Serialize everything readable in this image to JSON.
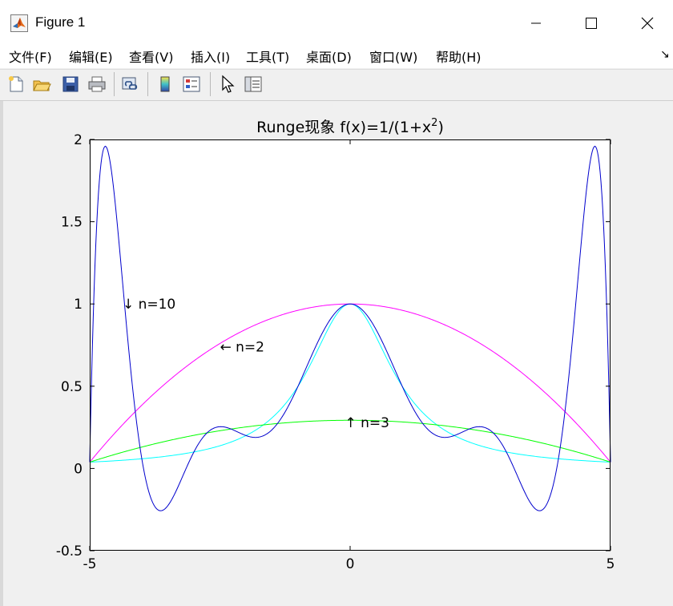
{
  "window": {
    "title": "Figure 1",
    "colors": {
      "titlebar": "#ffffff",
      "toolbar": "#f0f0f0",
      "figure_bg": "#f0f0f0"
    }
  },
  "menu": [
    "文件(F)",
    "编辑(E)",
    "查看(V)",
    "插入(I)",
    "工具(T)",
    "桌面(D)",
    "窗口(W)",
    "帮助(H)"
  ],
  "toolbar_icons": [
    "new-figure-icon",
    "open-file-icon",
    "save-icon",
    "print-icon",
    "link-plot-icon",
    "colorbar-icon",
    "legend-icon",
    "pointer-icon",
    "property-inspector-icon"
  ],
  "chart_data": {
    "type": "line",
    "title": "Runge现象 f(x)=1/(1+x",
    "title_superscript": "2",
    "title_close": ")",
    "xlabel": "",
    "ylabel": "",
    "xlim": [
      -5,
      5
    ],
    "ylim": [
      -0.5,
      2
    ],
    "xticks": [
      -5,
      0,
      5
    ],
    "yticks": [
      -0.5,
      0,
      0.5,
      1,
      1.5,
      2
    ],
    "xtick_labels": [
      "-5",
      "0",
      "5"
    ],
    "ytick_labels": [
      "-0.5",
      "0",
      "0.5",
      "1",
      "1.5",
      "2"
    ],
    "grid": false,
    "series": [
      {
        "color": "#00ffff",
        "function": "1/(1+x^2)",
        "nodes": []
      },
      {
        "color": "#ff00ff",
        "function": "lagrange",
        "nodes": [
          -5,
          0,
          5
        ]
      },
      {
        "color": "#00ff00",
        "function": "lagrange",
        "nodes": [
          -5,
          -1.6667,
          1.6667,
          5
        ]
      },
      {
        "color": "#0000cd",
        "function": "lagrange",
        "nodes": [
          -5,
          -4,
          -3,
          -2,
          -1,
          0,
          1,
          2,
          3,
          4,
          5
        ]
      }
    ],
    "annotations": [
      {
        "text": "↓ n=10",
        "x": -4.37,
        "y": 1.0
      },
      {
        "text": "← n=2",
        "x": -2.5,
        "y": 0.74
      },
      {
        "text": "↑ n=3",
        "x": -0.1,
        "y": 0.28
      }
    ]
  }
}
